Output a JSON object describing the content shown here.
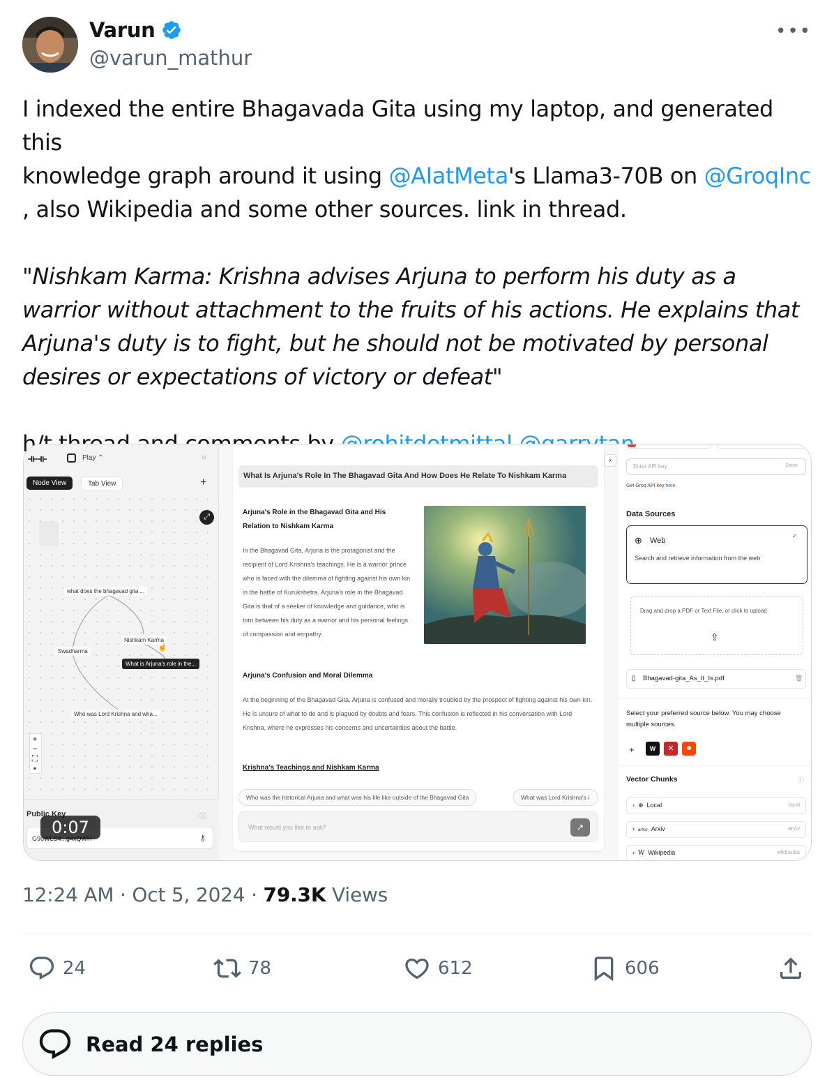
{
  "author": {
    "name": "Varun",
    "handle": "@varun_mathur",
    "verified": true
  },
  "tweet": {
    "line1": "I indexed the entire Bhagavada Gita using my laptop, and generated this",
    "line2_pre": "knowledge graph around it using ",
    "mention1": "@AIatMeta",
    "line2_mid": "'s Llama3-70B on ",
    "mention2": "@GroqInc",
    "line3": ", also Wikipedia and some other sources. link in thread.",
    "quote": "\"Nishkam Karma: Krishna advises Arjuna to perform his duty as a warrior without attachment to the fruits of his actions. He explains that Arjuna's duty is to fight, but he should not be motivated by personal desires or expectations of victory or defeat\"",
    "ht_pre": "h/t thread and comments by ",
    "mention3": "@rohitdotmittal",
    "mention4": "@garrytan"
  },
  "media": {
    "left": {
      "play_label": "Play",
      "node_view": "Node View",
      "tab_view": "Tab View",
      "nodes": {
        "root": "what does the bhagavad gita ...",
        "swadharma": "Swadharma",
        "nishkam": "Nishkam Karma",
        "selected": "What is Arjuna's role in the...",
        "krishna": "Who was Lord Krishna and wha..."
      },
      "public_key_label": "Public Key",
      "public_key_value": "G9uWLS4...g4xQWH"
    },
    "middle": {
      "query_title": "What Is Arjuna's Role In The Bhagavad Gita And How Does He Relate To Nishkam Karma",
      "h1": "Arjuna's Role in the Bhagavad Gita and His Relation to Nishkam Karma",
      "p1": "In the Bhagavad Gita, Arjuna is the protagonist and the recipient of Lord Krishna's teachings. He is a warrior prince who is faced with the dilemma of fighting against his own kin in the battle of Kurukshetra. Arjuna's role in the Bhagavad Gita is that of a seeker of knowledge and guidance, who is torn between his duty as a warrior and his personal feelings of compassion and empathy.",
      "h2": "Arjuna's Confusion and Moral Dilemma",
      "p2": "At the beginning of the Bhagavad Gita, Arjuna is confused and morally troubled by the prospect of fighting against his own kin. He is unsure of what to do and is plagued by doubts and fears. This confusion is reflected in his conversation with Lord Krishna, where he expresses his concerns and uncertainties about the battle.",
      "h3": "Krishna's Teachings and Nishkam Karma",
      "chip1": "Who was the historical Arjuna and what was his life like outside of the Bhagavad Gita",
      "chip2": "What was Lord Krishna's i",
      "ask_placeholder": "What would you like to ask?"
    },
    "right": {
      "api_placeholder": "Enter API key",
      "api_show": "Show",
      "groq_hint_pre": "Get Groq API key ",
      "groq_hint_link": "here.",
      "data_sources": "Data Sources",
      "web_title": "Web",
      "web_desc": "Search and retrieve information from the web",
      "upload_text": "Drag and drop a PDF or Text File, or click to upload",
      "file_name": "Bhagavad-gita_As_It_Is.pdf",
      "select_text": "Select your preferred source below. You may choose multiple sources.",
      "vector_chunks": "Vector Chunks",
      "rows": [
        {
          "label": "Local",
          "tag": "local"
        },
        {
          "label": "Arxiv",
          "tag": "arxiv"
        },
        {
          "label": "Wikipedia",
          "tag": "wikipedia"
        }
      ]
    },
    "timer": "0:07"
  },
  "meta": {
    "time": "12:24 AM",
    "sep1": " · ",
    "date": "Oct 5, 2024",
    "sep2": " · ",
    "views_count": "79.3K",
    "views_label": " Views"
  },
  "actions": {
    "replies": "24",
    "reposts": "78",
    "likes": "612",
    "bookmarks": "606"
  },
  "read_replies": "Read 24 replies",
  "colors": {
    "link": "#1d9bf0",
    "secondary_text": "#536471",
    "verified": "#1d9bf0"
  }
}
